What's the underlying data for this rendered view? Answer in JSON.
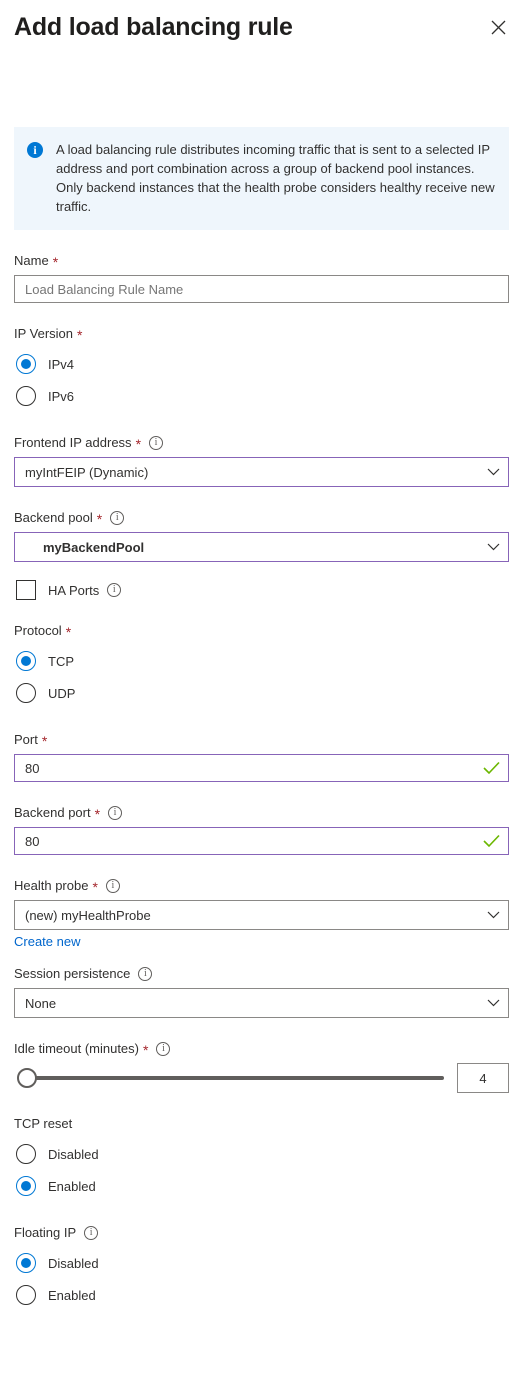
{
  "header": {
    "title": "Add load balancing rule",
    "close_label": "Close"
  },
  "info_banner": {
    "icon": "info-icon",
    "text": "A load balancing rule distributes incoming traffic that is sent to a selected IP address and port combination across a group of backend pool instances. Only backend instances that the health probe considers healthy receive new traffic."
  },
  "form": {
    "name": {
      "label": "Name",
      "required": "*",
      "placeholder": "Load Balancing Rule Name",
      "value": ""
    },
    "ip_version": {
      "label": "IP Version",
      "required": "*",
      "options": [
        {
          "label": "IPv4",
          "selected": true
        },
        {
          "label": "IPv6",
          "selected": false
        }
      ]
    },
    "frontend_ip": {
      "label": "Frontend IP address",
      "required": "*",
      "info": "i",
      "value": "myIntFEIP (Dynamic)"
    },
    "backend_pool": {
      "label": "Backend pool",
      "required": "*",
      "info": "i",
      "value": "myBackendPool"
    },
    "ha_ports": {
      "label": "HA Ports",
      "info": "i",
      "checked": false
    },
    "protocol": {
      "label": "Protocol",
      "required": "*",
      "options": [
        {
          "label": "TCP",
          "selected": true
        },
        {
          "label": "UDP",
          "selected": false
        }
      ]
    },
    "port": {
      "label": "Port",
      "required": "*",
      "value": "80",
      "valid": true
    },
    "backend_port": {
      "label": "Backend port",
      "required": "*",
      "info": "i",
      "value": "80",
      "valid": true
    },
    "health_probe": {
      "label": "Health probe",
      "required": "*",
      "info": "i",
      "value": "(new) myHealthProbe",
      "create_new_link": "Create new"
    },
    "session_persistence": {
      "label": "Session persistence",
      "info": "i",
      "value": "None"
    },
    "idle_timeout": {
      "label": "Idle timeout (minutes)",
      "required": "*",
      "info": "i",
      "value": "4",
      "min": 4,
      "max": 30
    },
    "tcp_reset": {
      "label": "TCP reset",
      "options": [
        {
          "label": "Disabled",
          "selected": false
        },
        {
          "label": "Enabled",
          "selected": true
        }
      ]
    },
    "floating_ip": {
      "label": "Floating IP",
      "info": "i",
      "options": [
        {
          "label": "Disabled",
          "selected": true
        },
        {
          "label": "Enabled",
          "selected": false
        }
      ]
    }
  },
  "colors": {
    "accent_blue": "#0078d4",
    "link_blue": "#0066cc",
    "required_red": "#a4262c",
    "focus_purple": "#8764b8",
    "valid_green": "#6bb700",
    "banner_bg": "#eff6fc"
  }
}
